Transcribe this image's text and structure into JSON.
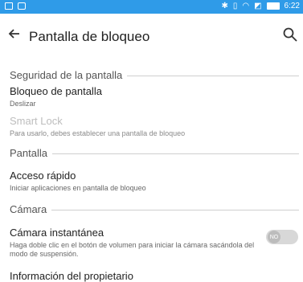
{
  "statusbar": {
    "time": "6:22"
  },
  "appbar": {
    "title": "Pantalla de bloqueo"
  },
  "sections": {
    "security": "Seguridad de la pantalla",
    "display": "Pantalla",
    "camera": "Cámara"
  },
  "items": {
    "lock_screen": {
      "title": "Bloqueo de pantalla",
      "subtitle": "Deslizar"
    },
    "smart_lock": {
      "title": "Smart Lock",
      "subtitle": "Para usarlo, debes establecer una pantalla de bloqueo"
    },
    "quick_access": {
      "title": "Acceso rápido",
      "subtitle": "Iniciar aplicaciones en pantalla de bloqueo"
    },
    "instant_camera": {
      "title": "Cámara instantánea",
      "subtitle": "Haga doble clic en el botón de volumen para iniciar la cámara sacándola del modo de suspensión.",
      "toggle_label": "NO"
    },
    "owner_info": {
      "title": "Información del propietario"
    }
  },
  "colors": {
    "statusbar": "#2f9be8"
  }
}
